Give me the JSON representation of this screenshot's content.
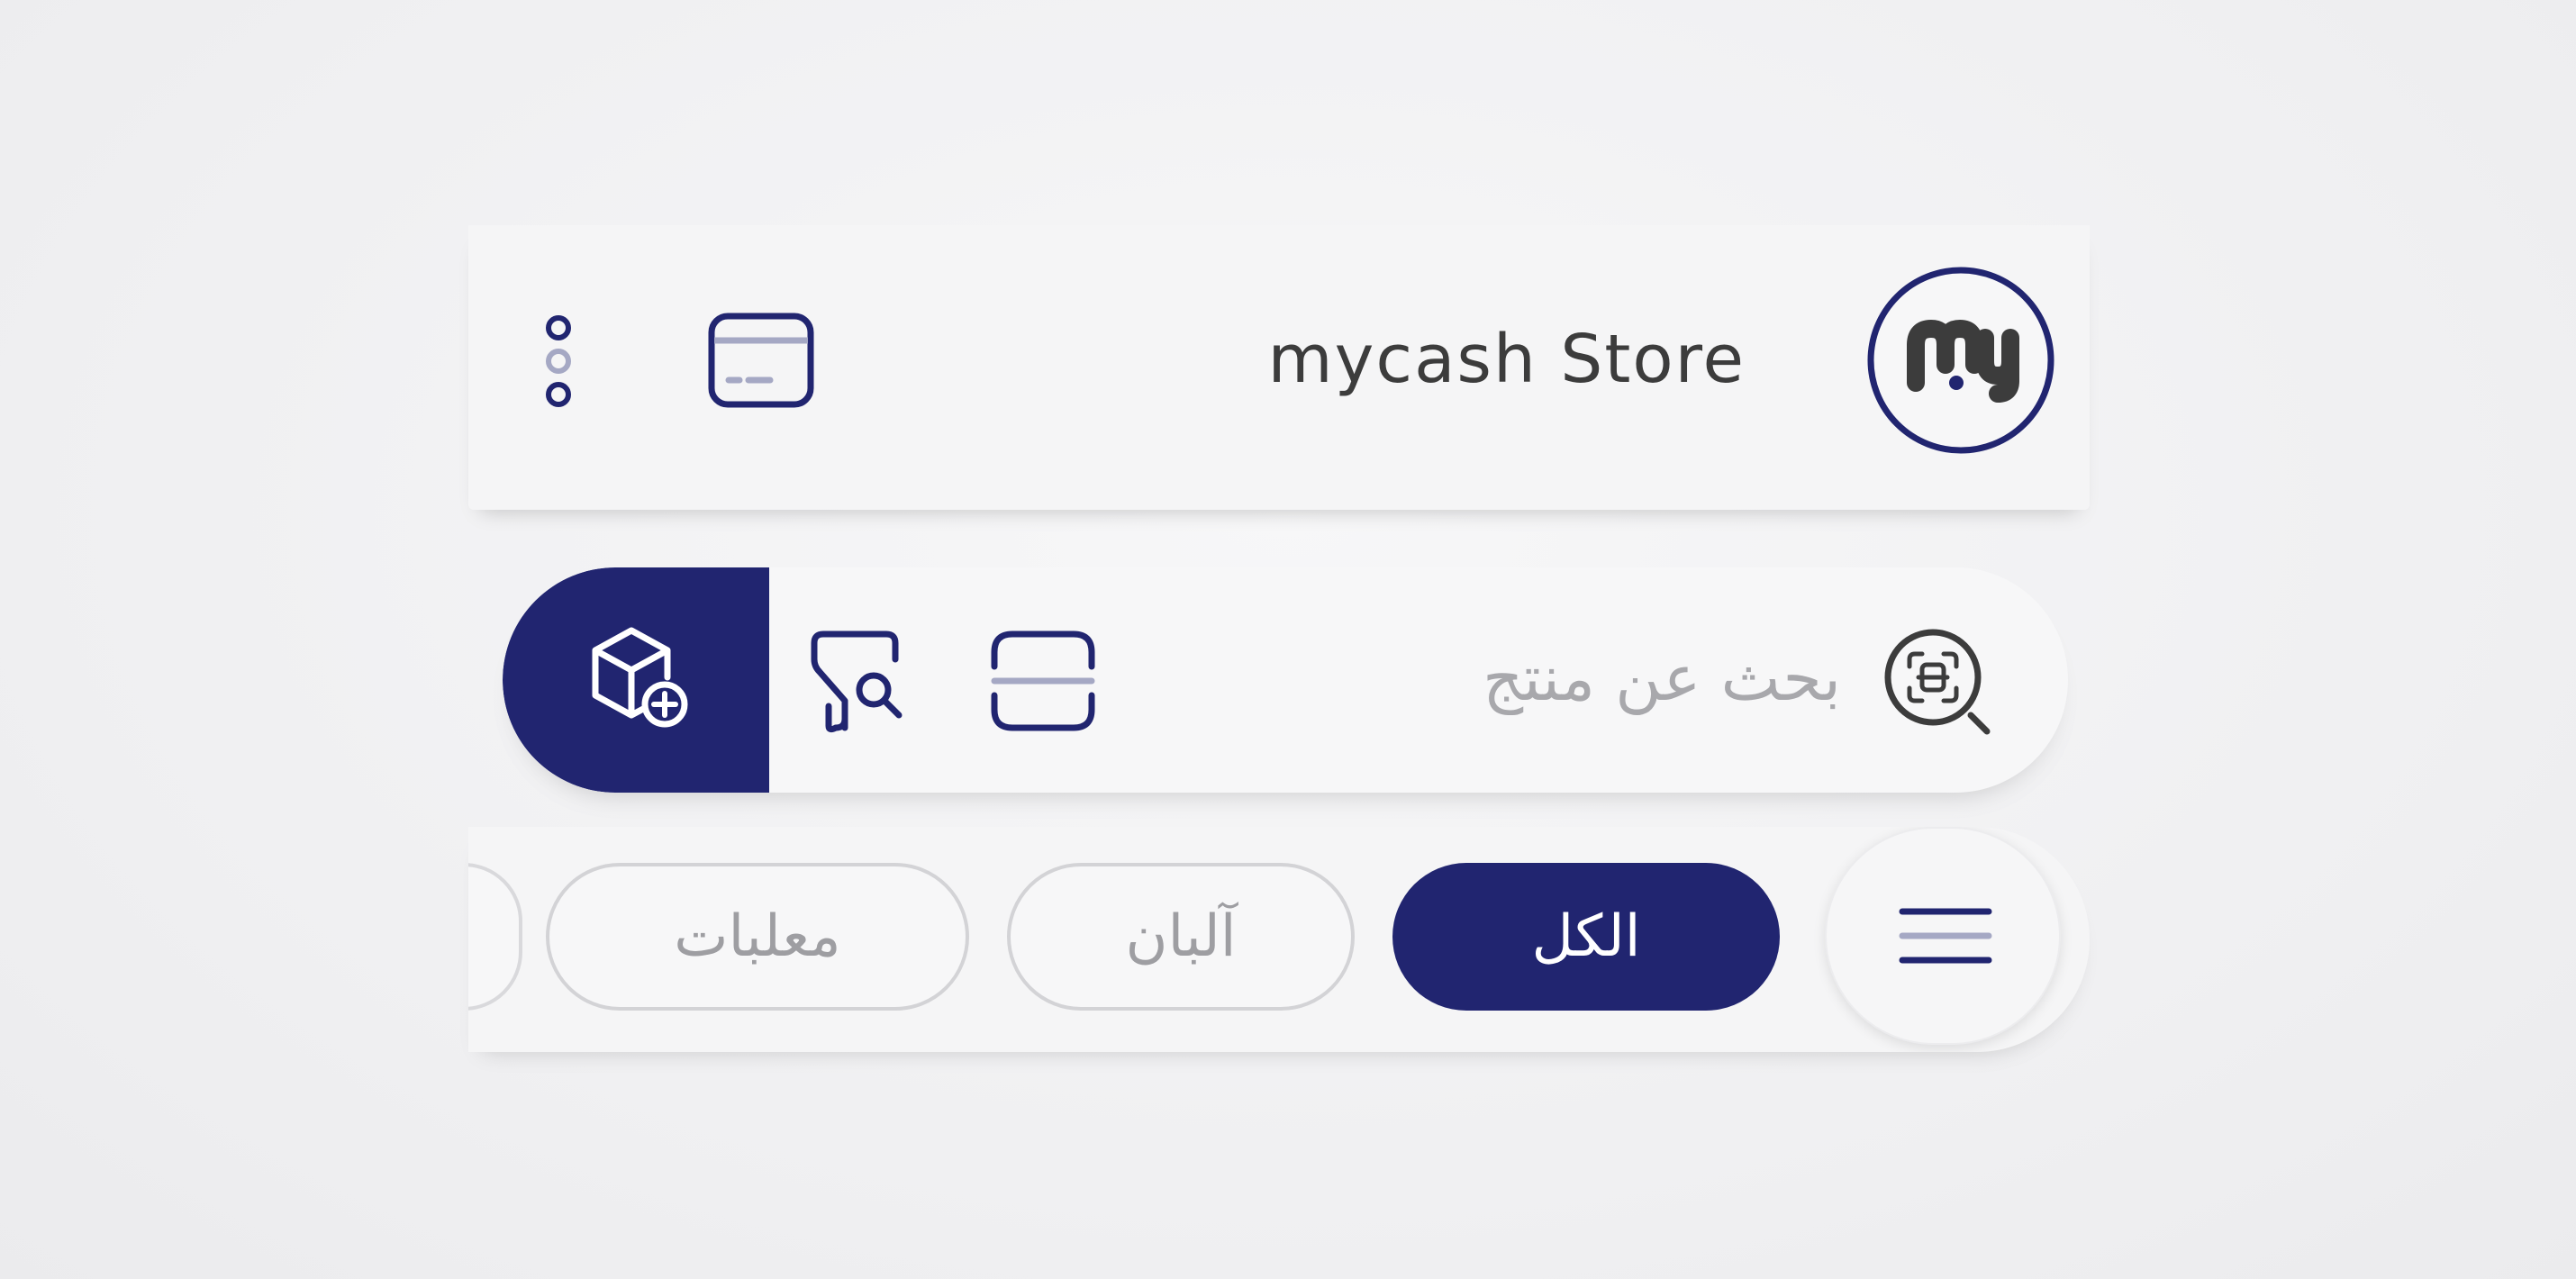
{
  "header": {
    "store_name": "mycash Store",
    "logo_icon": "mycash-logo-icon",
    "card_icon": "credit-card-icon",
    "more_icon": "vertical-dots-icon"
  },
  "search": {
    "placeholder": "بحث عن منتج",
    "ai_icon": "ai-search-icon",
    "scan_icon": "barcode-scan-icon",
    "filter_icon": "filter-search-icon",
    "add_icon": "add-product-icon"
  },
  "categories": {
    "menu_icon": "hamburger-menu-icon",
    "items": [
      {
        "label": "الكل",
        "active": true
      },
      {
        "label": "آلبان",
        "active": false
      },
      {
        "label": "معلبات",
        "active": false
      }
    ]
  },
  "colors": {
    "primary": "#212570",
    "text": "#3c3c3c",
    "muted": "#a8a8ac",
    "background": "#f5f5f6"
  }
}
